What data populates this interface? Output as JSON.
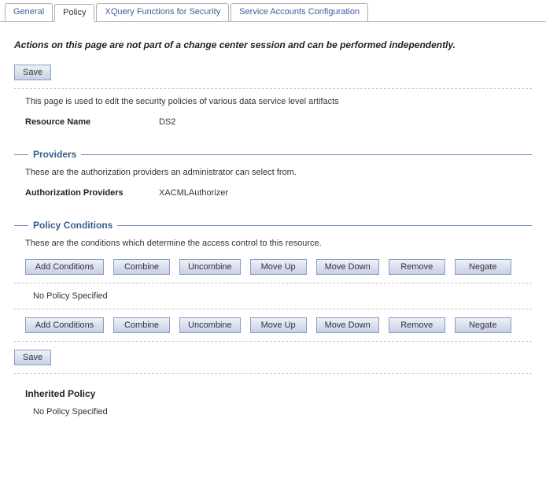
{
  "tabs": {
    "general": "General",
    "policy": "Policy",
    "xquery": "XQuery Functions for Security",
    "service_accounts": "Service Accounts Configuration"
  },
  "notice": "Actions on this page are not part of a change center session and can be performed independently.",
  "buttons": {
    "save": "Save",
    "add_conditions": "Add Conditions",
    "combine": "Combine",
    "uncombine": "Uncombine",
    "move_up": "Move Up",
    "move_down": "Move Down",
    "remove": "Remove",
    "negate": "Negate"
  },
  "page_desc": "This page is used to edit the security policies of various data service level artifacts",
  "resource": {
    "label": "Resource Name",
    "value": "DS2"
  },
  "providers": {
    "title": "Providers",
    "desc": "These are the authorization providers an administrator can select from.",
    "label": "Authorization Providers",
    "value": "XACMLAuthorizer"
  },
  "policy_conditions": {
    "title": "Policy Conditions",
    "desc": "These are the conditions which determine the access control to this resource.",
    "no_policy": "No Policy Specified"
  },
  "inherited": {
    "title": "Inherited Policy",
    "no_policy": "No Policy Specified"
  }
}
